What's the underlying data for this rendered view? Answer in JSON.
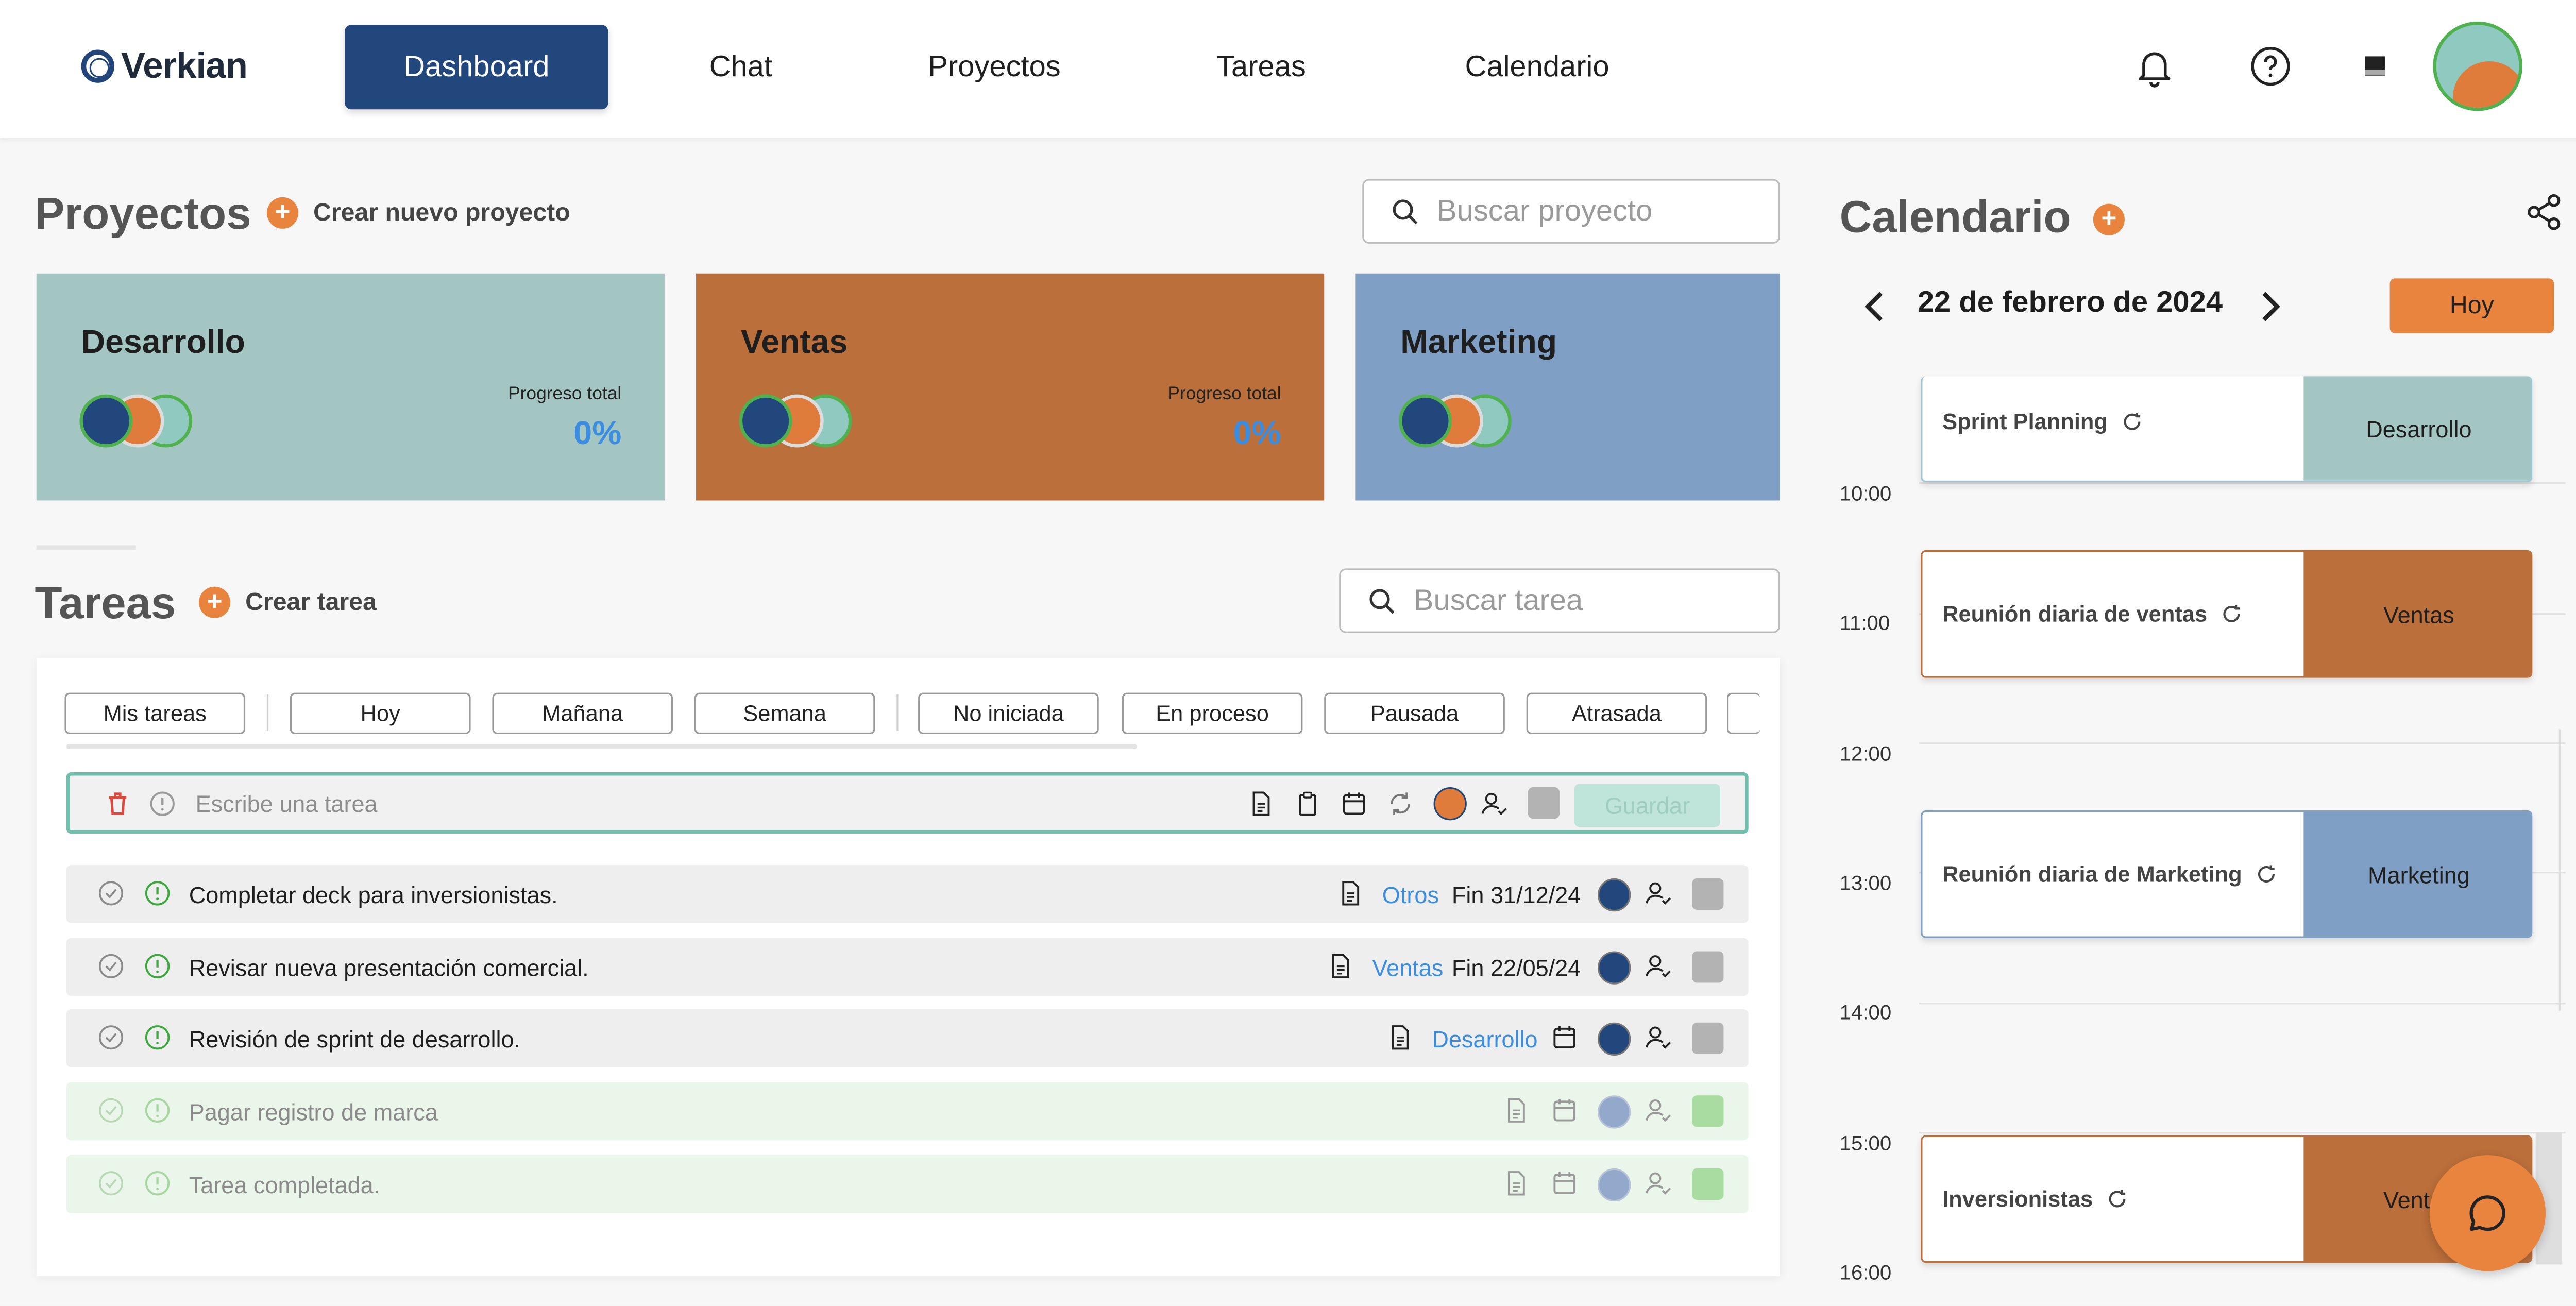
{
  "nav": {
    "brand": "Verkian",
    "links": [
      "Dashboard",
      "Chat",
      "Proyectos",
      "Tareas",
      "Calendario"
    ],
    "active": "Dashboard",
    "accent_color": "#21477c"
  },
  "projects": {
    "title": "Proyectos",
    "create_label": "Crear nuevo proyecto",
    "search_placeholder": "Buscar proyecto",
    "cards": [
      {
        "name": "Desarrollo",
        "progress_label": "Progreso total",
        "progress": "0%",
        "color": "#a4c6c3"
      },
      {
        "name": "Ventas",
        "progress_label": "Progreso total",
        "progress": "0%",
        "color": "#bb6f3b"
      },
      {
        "name": "Marketing",
        "progress_label": "",
        "progress": "",
        "color": "#7f9fc4"
      }
    ]
  },
  "tasks": {
    "title": "Tareas",
    "create_label": "Crear tarea",
    "search_placeholder": "Buscar tarea",
    "filters": [
      "Mis tareas",
      "Hoy",
      "Mañana",
      "Semana",
      "No iniciada",
      "En proceso",
      "Pausada",
      "Atrasada"
    ],
    "new_task_placeholder": "Escribe una tarea",
    "save_label": "Guardar",
    "rows": [
      {
        "text": "Completar deck para inversionistas.",
        "tag": "Otros",
        "due": "Fin 31/12/24",
        "done": false
      },
      {
        "text": "Revisar nueva presentación comercial.",
        "tag": "Ventas",
        "due": "Fin 22/05/24",
        "done": false
      },
      {
        "text": "Revisión de sprint de desarrollo.",
        "tag": "Desarrollo",
        "due": "",
        "done": false
      },
      {
        "text": "Pagar registro de marca",
        "tag": "",
        "due": "",
        "done": true
      },
      {
        "text": "Tarea completada.",
        "tag": "",
        "due": "",
        "done": true
      }
    ]
  },
  "calendar": {
    "title": "Calendario",
    "date": "22 de febrero de 2024",
    "today_label": "Hoy",
    "hours": [
      "10:00",
      "11:00",
      "12:00",
      "13:00",
      "14:00",
      "15:00",
      "16:00"
    ],
    "events": [
      {
        "name": "Sprint Planning",
        "project": "Desarrollo",
        "color": "#a4c6c3"
      },
      {
        "name": "Reunión diaria de ventas",
        "project": "Ventas",
        "color": "#bb6f3b"
      },
      {
        "name": "Reunión diaria de Marketing",
        "project": "Marketing",
        "color": "#7f9fc4"
      },
      {
        "name": "Inversionistas",
        "project": "Ventas",
        "color": "#bb6f3b"
      }
    ]
  }
}
